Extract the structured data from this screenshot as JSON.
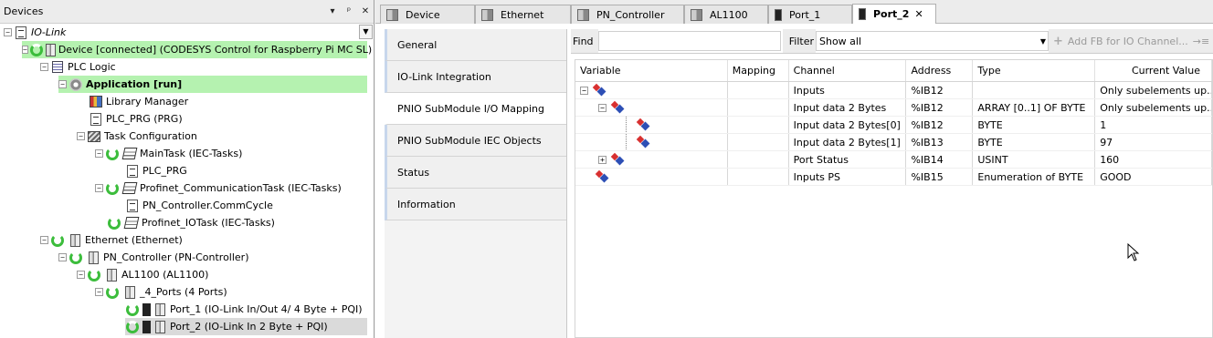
{
  "devices": {
    "title": "Devices",
    "header_buttons": [
      "▾",
      "ᵖ",
      "✕"
    ],
    "tree": [
      {
        "label": "IO-Link",
        "italic": true
      },
      {
        "label": "Device [connected] (CODESYS Control for Raspberry Pi MC SL)"
      },
      {
        "label": "PLC Logic"
      },
      {
        "label": "Application [run]",
        "bold": true
      },
      {
        "label": "Library Manager"
      },
      {
        "label": "PLC_PRG (PRG)"
      },
      {
        "label": "Task Configuration"
      },
      {
        "label": "MainTask (IEC-Tasks)"
      },
      {
        "label": "PLC_PRG"
      },
      {
        "label": "Profinet_CommunicationTask (IEC-Tasks)"
      },
      {
        "label": "PN_Controller.CommCycle"
      },
      {
        "label": "Profinet_IOTask (IEC-Tasks)"
      },
      {
        "label": "Ethernet (Ethernet)"
      },
      {
        "label": "PN_Controller (PN-Controller)"
      },
      {
        "label": "AL1100 (AL1100)"
      },
      {
        "label": "_4_Ports (4 Ports)"
      },
      {
        "label": "Port_1 (IO-Link In/Out  4/ 4 Byte + PQI)"
      },
      {
        "label": "Port_2 (IO-Link In  2 Byte + PQI)"
      }
    ],
    "highlight_color": "#b5f2b0"
  },
  "tabs": [
    {
      "label": "Device"
    },
    {
      "label": "Ethernet"
    },
    {
      "label": "PN_Controller"
    },
    {
      "label": "AL1100"
    },
    {
      "label": "Port_1"
    },
    {
      "label": "Port_2",
      "active": true,
      "close": "✕"
    }
  ],
  "side_tabs": [
    {
      "label": "General"
    },
    {
      "label": "IO-Link Integration"
    },
    {
      "label": "PNIO SubModule I/O Mapping",
      "active": true
    },
    {
      "label": "PNIO SubModule IEC Objects"
    },
    {
      "label": "Status"
    },
    {
      "label": "Information"
    }
  ],
  "toolbar": {
    "find_label": "Find",
    "filter_label": "Filter",
    "filter_value": "Show all",
    "add_fb_label": "Add FB for IO Channel...",
    "goto_icon": "goto-instance-icon"
  },
  "grid": {
    "columns": [
      "Variable",
      "Mapping",
      "Channel",
      "Address",
      "Type",
      "Current Value"
    ],
    "rows": [
      {
        "channel": "Inputs",
        "address": "%IB12",
        "type": "",
        "value": "Only subelements up..."
      },
      {
        "channel": "Input data 2 Bytes",
        "address": "%IB12",
        "type": "ARRAY [0..1] OF BYTE",
        "value": "Only subelements up..."
      },
      {
        "channel": "Input data 2 Bytes[0]",
        "address": "%IB12",
        "type": "BYTE",
        "value": "1"
      },
      {
        "channel": "Input data 2 Bytes[1]",
        "address": "%IB13",
        "type": "BYTE",
        "value": "97"
      },
      {
        "channel": "Port Status",
        "address": "%IB14",
        "type": "USINT",
        "value": "160"
      },
      {
        "channel": "Inputs PS",
        "address": "%IB15",
        "type": "Enumeration of BYTE",
        "value": "GOOD"
      }
    ]
  }
}
